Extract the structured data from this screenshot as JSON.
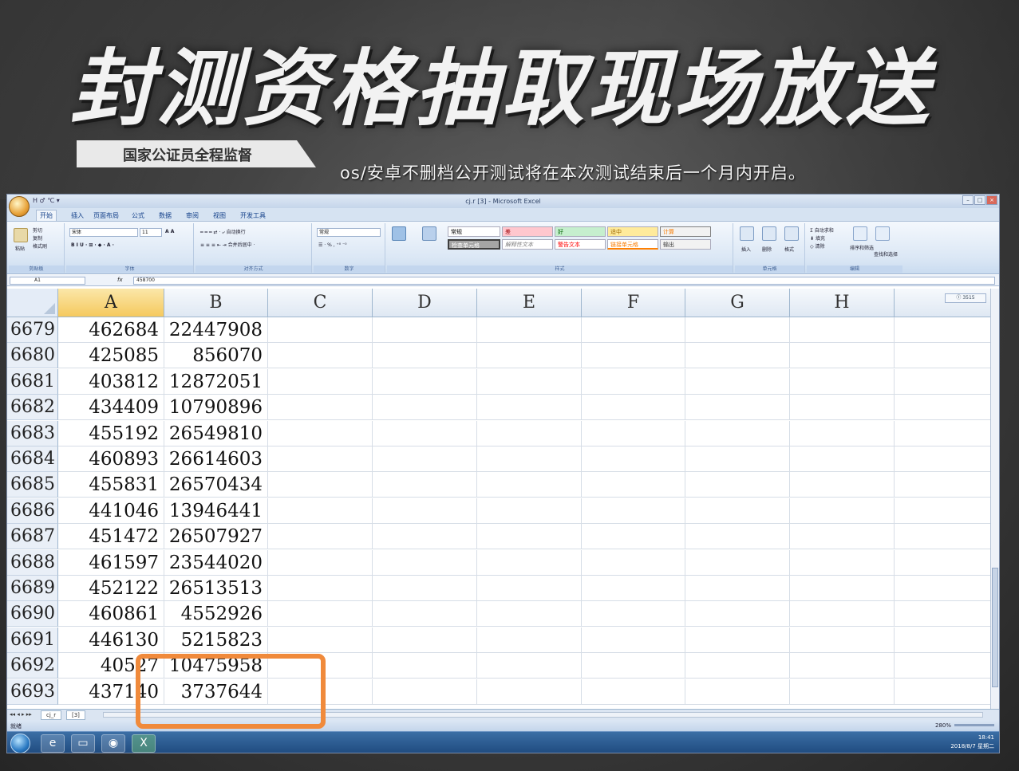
{
  "overlay": {
    "headline": "封测资格抽取现场放送",
    "banner": "国家公证员全程监督",
    "subline": "os/安卓不删档公开测试将在本次测试结束后一个月内开启。"
  },
  "window": {
    "title": "cj.r [3] - Microsoft Excel",
    "qat": "H ♂ ℃ ▾",
    "controls": [
      "–",
      "□",
      "×"
    ]
  },
  "ribbon": {
    "tabs": [
      "开始",
      "插入",
      "页面布局",
      "公式",
      "数据",
      "审阅",
      "视图",
      "开发工具"
    ],
    "groups": [
      "剪贴板",
      "字体",
      "对齐方式",
      "数字",
      "样式",
      "单元格",
      "编辑"
    ],
    "clipboard": [
      "剪切",
      "复制",
      "格式刷",
      "粘贴"
    ],
    "font_name": "宋体",
    "font_size": "11",
    "number_format": "常规",
    "styles": [
      "常规",
      "差",
      "好",
      "适中",
      "计算",
      "检查单元格",
      "解释性文本",
      "警告文本",
      "链接单元格",
      "输出"
    ],
    "cells_buttons": [
      "插入",
      "删除",
      "格式"
    ],
    "editing_buttons": [
      "自动求和",
      "填充",
      "清除",
      "排序和筛选",
      "查找和选择"
    ]
  },
  "formula_bar": {
    "name_box": "A1",
    "fx": "fx",
    "value": "458700"
  },
  "grid": {
    "columns": [
      "A",
      "B",
      "C",
      "D",
      "E",
      "F",
      "G",
      "H"
    ],
    "selected_column": "A",
    "rows": [
      {
        "num": "6679",
        "a": "462684",
        "b": "22447908"
      },
      {
        "num": "6680",
        "a": "425085",
        "b": "856070"
      },
      {
        "num": "6681",
        "a": "403812",
        "b": "12872051"
      },
      {
        "num": "6682",
        "a": "434409",
        "b": "10790896"
      },
      {
        "num": "6683",
        "a": "455192",
        "b": "26549810"
      },
      {
        "num": "6684",
        "a": "460893",
        "b": "26614603"
      },
      {
        "num": "6685",
        "a": "455831",
        "b": "26570434"
      },
      {
        "num": "6686",
        "a": "441046",
        "b": "13946441"
      },
      {
        "num": "6687",
        "a": "451472",
        "b": "26507927"
      },
      {
        "num": "6688",
        "a": "461597",
        "b": "23544020"
      },
      {
        "num": "6689",
        "a": "452122",
        "b": "26513513"
      },
      {
        "num": "6690",
        "a": "460861",
        "b": "4552926"
      },
      {
        "num": "6691",
        "a": "446130",
        "b": "5215823"
      },
      {
        "num": "6692",
        "a": "40527",
        "b": "10475958"
      },
      {
        "num": "6693",
        "a": "437140",
        "b": "3737644"
      }
    ]
  },
  "split_label": "Ⓘ 3515",
  "sheet_tabs": [
    "cj_r",
    "[3]"
  ],
  "status": {
    "left": "就绪",
    "zoom": "280%"
  },
  "taskbar": {
    "time": "18:41",
    "date": "2018/8/7 星期二"
  },
  "colors": {
    "highlight": "#f08a3b",
    "selected_header": "#f5c95e"
  }
}
